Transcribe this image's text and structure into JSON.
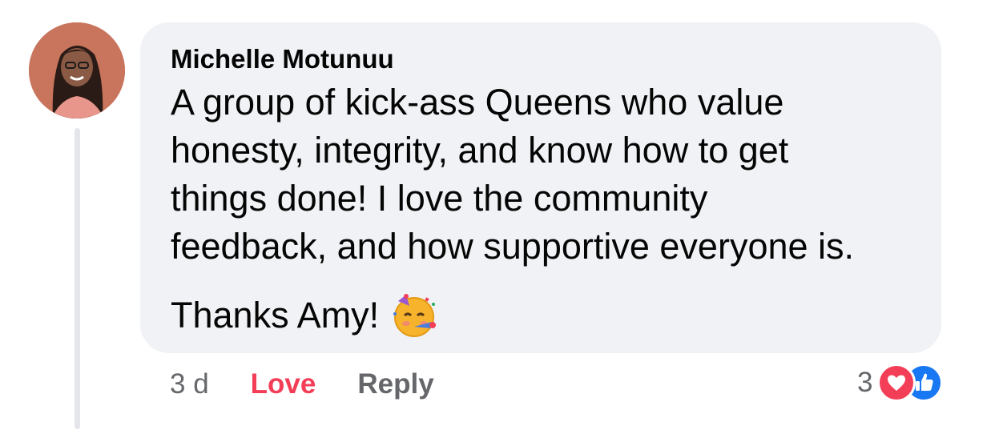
{
  "comment": {
    "author": "Michelle Motunuu",
    "text_lines": [
      "A group of kick-ass Queens who value",
      "honesty, integrity, and know how to get",
      "things done! I love the community",
      "feedback, and how supportive everyone is."
    ],
    "thanks": "Thanks Amy!",
    "emoji_icon": "partying-face-emoji"
  },
  "actions": {
    "time": "3 d",
    "love_label": "Love",
    "reply_label": "Reply"
  },
  "reactions": {
    "count": "3",
    "types": [
      "love",
      "like"
    ]
  },
  "colors": {
    "bubble_bg": "#f0f2f5",
    "love": "#f33e58",
    "like": "#1877f2",
    "muted": "#65676b"
  }
}
